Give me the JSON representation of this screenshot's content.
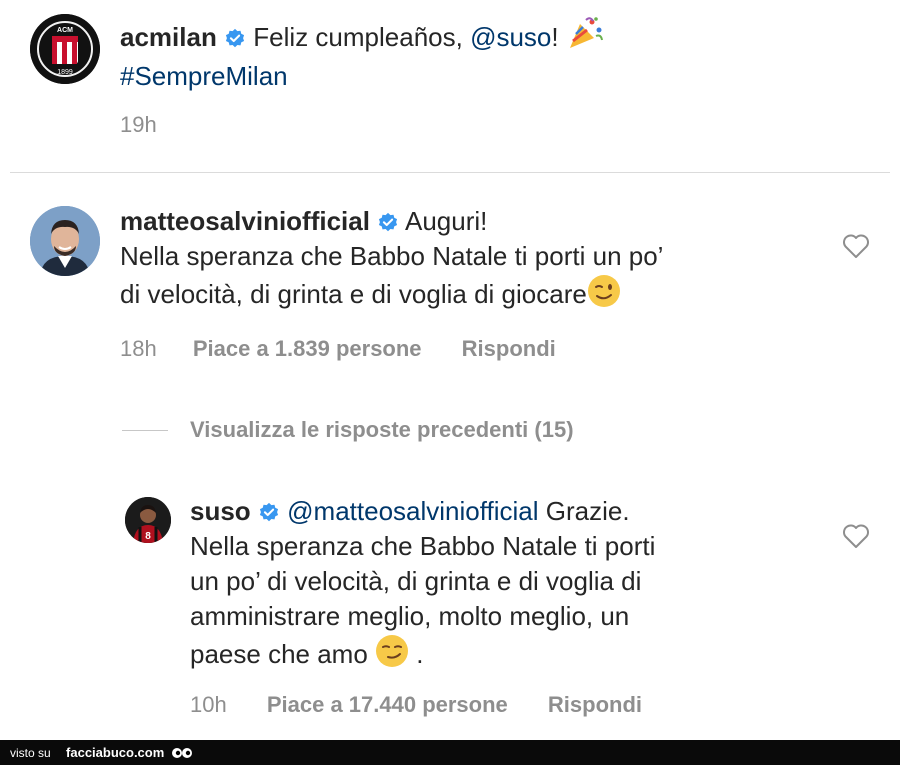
{
  "post": {
    "username": "acmilan",
    "text": "Feliz cumpleaños,",
    "mention": "@suso",
    "exclaim": "!",
    "hashtag": "#SempreMilan",
    "time": "19h",
    "avatar_text_top": "ACM",
    "avatar_year": "1899"
  },
  "comment1": {
    "username": "matteosalviniofficial",
    "first_line": "Auguri!",
    "line2": "Nella speranza che Babbo Natale ti porti un po’",
    "line3": "di velocità, di grinta e di voglia di giocare",
    "time": "18h",
    "likes": "Piace a 1.839 persone",
    "reply": "Rispondi"
  },
  "view_replies": "Visualizza le risposte precedenti (15)",
  "reply1": {
    "username": "suso",
    "mention": "@matteosalviniofficial",
    "first_word": "Grazie.",
    "line2": "Nella speranza che Babbo Natale ti porti",
    "line3": "un po’ di velocità, di grinta e di voglia di",
    "line4": "amministrare meglio, molto meglio, un",
    "line5": "paese che amo",
    "line5_end": ".",
    "time": "10h",
    "likes": "Piace a 17.440 persone",
    "reply": "Rispondi",
    "jersey_number": "8"
  },
  "footer": {
    "prefix": "visto su",
    "site": "facciabuco.com"
  },
  "colors": {
    "text": "#262626",
    "secondary": "#8e8e8e",
    "link": "#00376b",
    "verified": "#3897f0",
    "milan_red": "#c8102e"
  }
}
